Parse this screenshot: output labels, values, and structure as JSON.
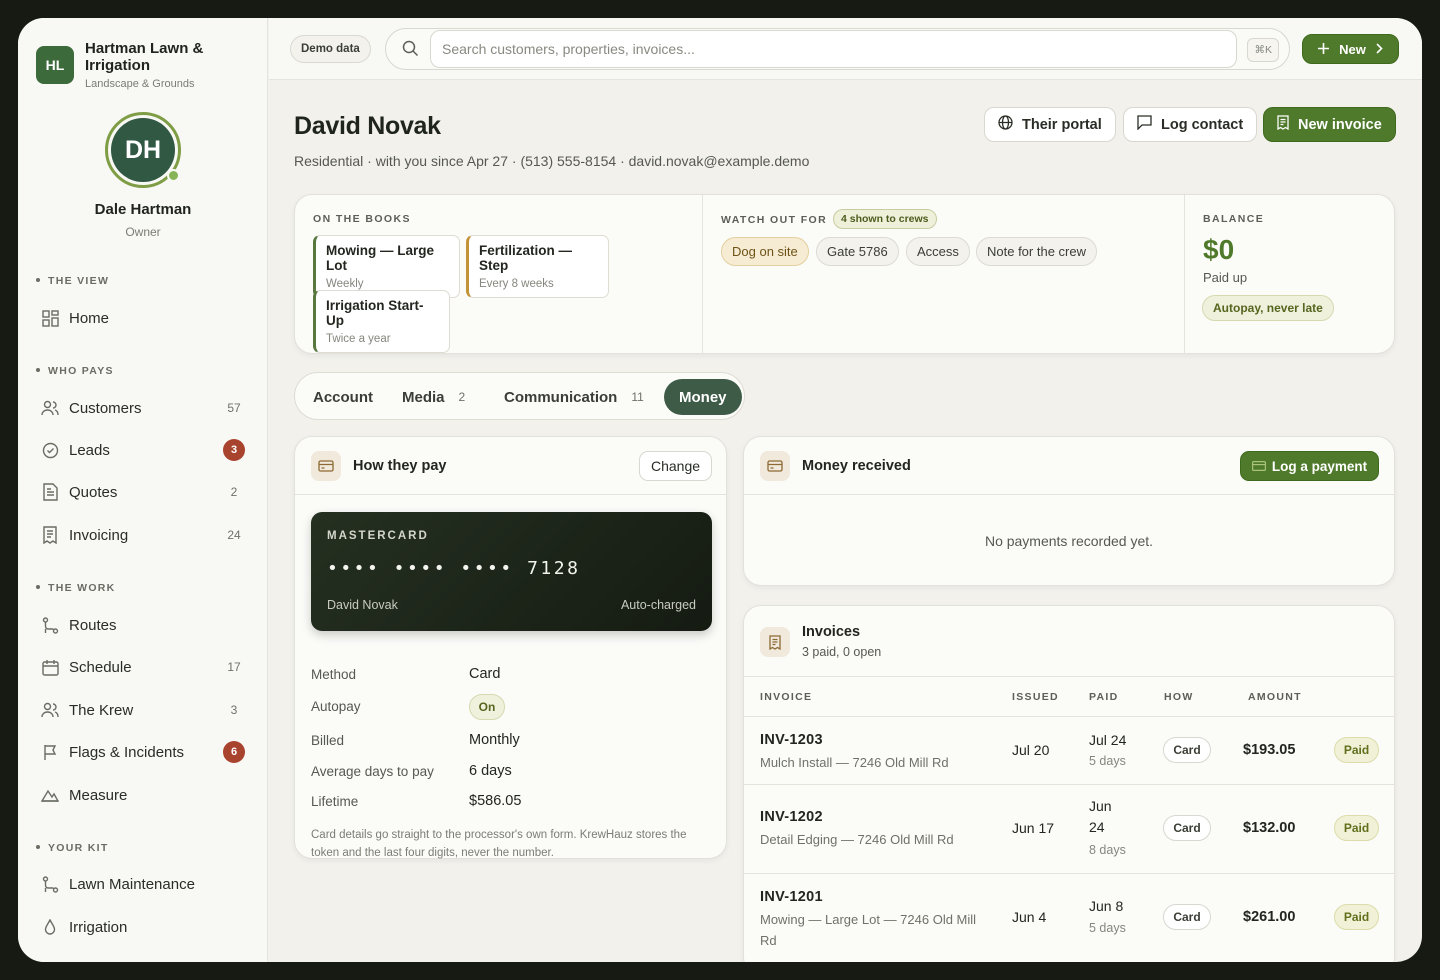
{
  "brand": {
    "initials": "HL",
    "name": "Hartman Lawn & Irrigation",
    "tagline": "Landscape & Grounds"
  },
  "user": {
    "initials": "DH",
    "name": "Dale Hartman",
    "role": "Owner"
  },
  "sidebar": {
    "sections": [
      {
        "label": "THE VIEW"
      },
      {
        "label": "WHO PAYS"
      },
      {
        "label": "THE WORK"
      },
      {
        "label": "YOUR KIT"
      }
    ],
    "items": [
      {
        "label": "Home",
        "icon": "grid-icon",
        "count": ""
      },
      {
        "label": "Customers",
        "icon": "users-icon",
        "count": "57"
      },
      {
        "label": "Leads",
        "icon": "check-circle-icon",
        "count": "3",
        "alert": true
      },
      {
        "label": "Quotes",
        "icon": "document-icon",
        "count": "2"
      },
      {
        "label": "Invoicing",
        "icon": "receipt-icon",
        "count": "24"
      },
      {
        "label": "Routes",
        "icon": "route-icon",
        "count": ""
      },
      {
        "label": "Schedule",
        "icon": "calendar-icon",
        "count": "17"
      },
      {
        "label": "The Krew",
        "icon": "users-icon",
        "count": "3"
      },
      {
        "label": "Flags & Incidents",
        "icon": "flag-icon",
        "count": "6",
        "alert": true
      },
      {
        "label": "Measure",
        "icon": "terrain-icon",
        "count": ""
      },
      {
        "label": "Lawn Maintenance",
        "icon": "route-icon",
        "count": ""
      },
      {
        "label": "Irrigation",
        "icon": "droplet-icon",
        "count": ""
      }
    ]
  },
  "topbar": {
    "demo_label": "Demo data",
    "search_placeholder": "Search customers, properties, invoices...",
    "shortcut": "⌘K",
    "new_label": "New"
  },
  "customer": {
    "name": "David Novak",
    "subtitle": "Residential · with you since Apr 27 · (513) 555-8154 · david.novak@example.demo"
  },
  "header_actions": {
    "portal": "Their portal",
    "log_contact": "Log contact",
    "new_invoice": "New invoice"
  },
  "books": {
    "label": "ON THE BOOKS",
    "services": [
      {
        "title": "Mowing — Large Lot",
        "freq": "Weekly"
      },
      {
        "title": "Fertilization — Step",
        "freq": "Every 8 weeks"
      },
      {
        "title": "Irrigation Start-Up",
        "freq": "Twice a year"
      }
    ]
  },
  "watch": {
    "label": "WATCH OUT FOR",
    "badge": "4 shown to crews",
    "chips": [
      "Dog on site",
      "Gate 5786",
      "Access",
      "Note for the crew"
    ]
  },
  "balance": {
    "label": "BALANCE",
    "amount": "$0",
    "status": "Paid up",
    "pill": "Autopay, never late"
  },
  "tabs": [
    {
      "label": "Account",
      "count": ""
    },
    {
      "label": "Media",
      "count": "2"
    },
    {
      "label": "Communication",
      "count": "11"
    },
    {
      "label": "Money",
      "count": "",
      "active": true
    }
  ],
  "how_pay": {
    "title": "How they pay",
    "change": "Change",
    "card": {
      "brand": "MASTERCARD",
      "masked": "•••• •••• ••••",
      "last4": "7128",
      "holder": "David Novak",
      "mode": "Auto-charged"
    },
    "rows": [
      {
        "k": "Method",
        "v": "Card"
      },
      {
        "k": "Autopay",
        "v": "On"
      },
      {
        "k": "Billed",
        "v": "Monthly"
      },
      {
        "k": "Average days to pay",
        "v": "6 days"
      },
      {
        "k": "Lifetime",
        "v": "$586.05"
      }
    ],
    "note": "Card details go straight to the processor's own form. KrewHauz stores the token and the last four digits, never the number."
  },
  "money_received": {
    "title": "Money received",
    "button": "Log a payment",
    "empty": "No payments recorded yet."
  },
  "invoices": {
    "title": "Invoices",
    "summary": "3 paid, 0 open",
    "columns": [
      "INVOICE",
      "ISSUED",
      "PAID",
      "HOW",
      "AMOUNT"
    ],
    "rows": [
      {
        "id": "INV-1203",
        "desc": "Mulch Install — 7246 Old Mill Rd",
        "issued": "Jul 20",
        "paid": "Jul 24",
        "days": "5 days",
        "how": "Card",
        "amount": "$193.05",
        "status": "Paid"
      },
      {
        "id": "INV-1202",
        "desc": "Detail Edging — 7246 Old Mill Rd",
        "issued": "Jun 17",
        "paid": "Jun 24",
        "days": "8 days",
        "how": "Card",
        "amount": "$132.00",
        "status": "Paid"
      },
      {
        "id": "INV-1201",
        "desc": "Mowing — Large Lot — 7246 Old Mill Rd",
        "issued": "Jun 4",
        "paid": "Jun 8",
        "days": "5 days",
        "how": "Card",
        "amount": "$261.00",
        "status": "Paid"
      }
    ]
  },
  "colors": {
    "accent": "#4f7a2b",
    "alert": "#a8432e",
    "tab_active": "#3e5b48",
    "card_dark": "#1d2519"
  }
}
